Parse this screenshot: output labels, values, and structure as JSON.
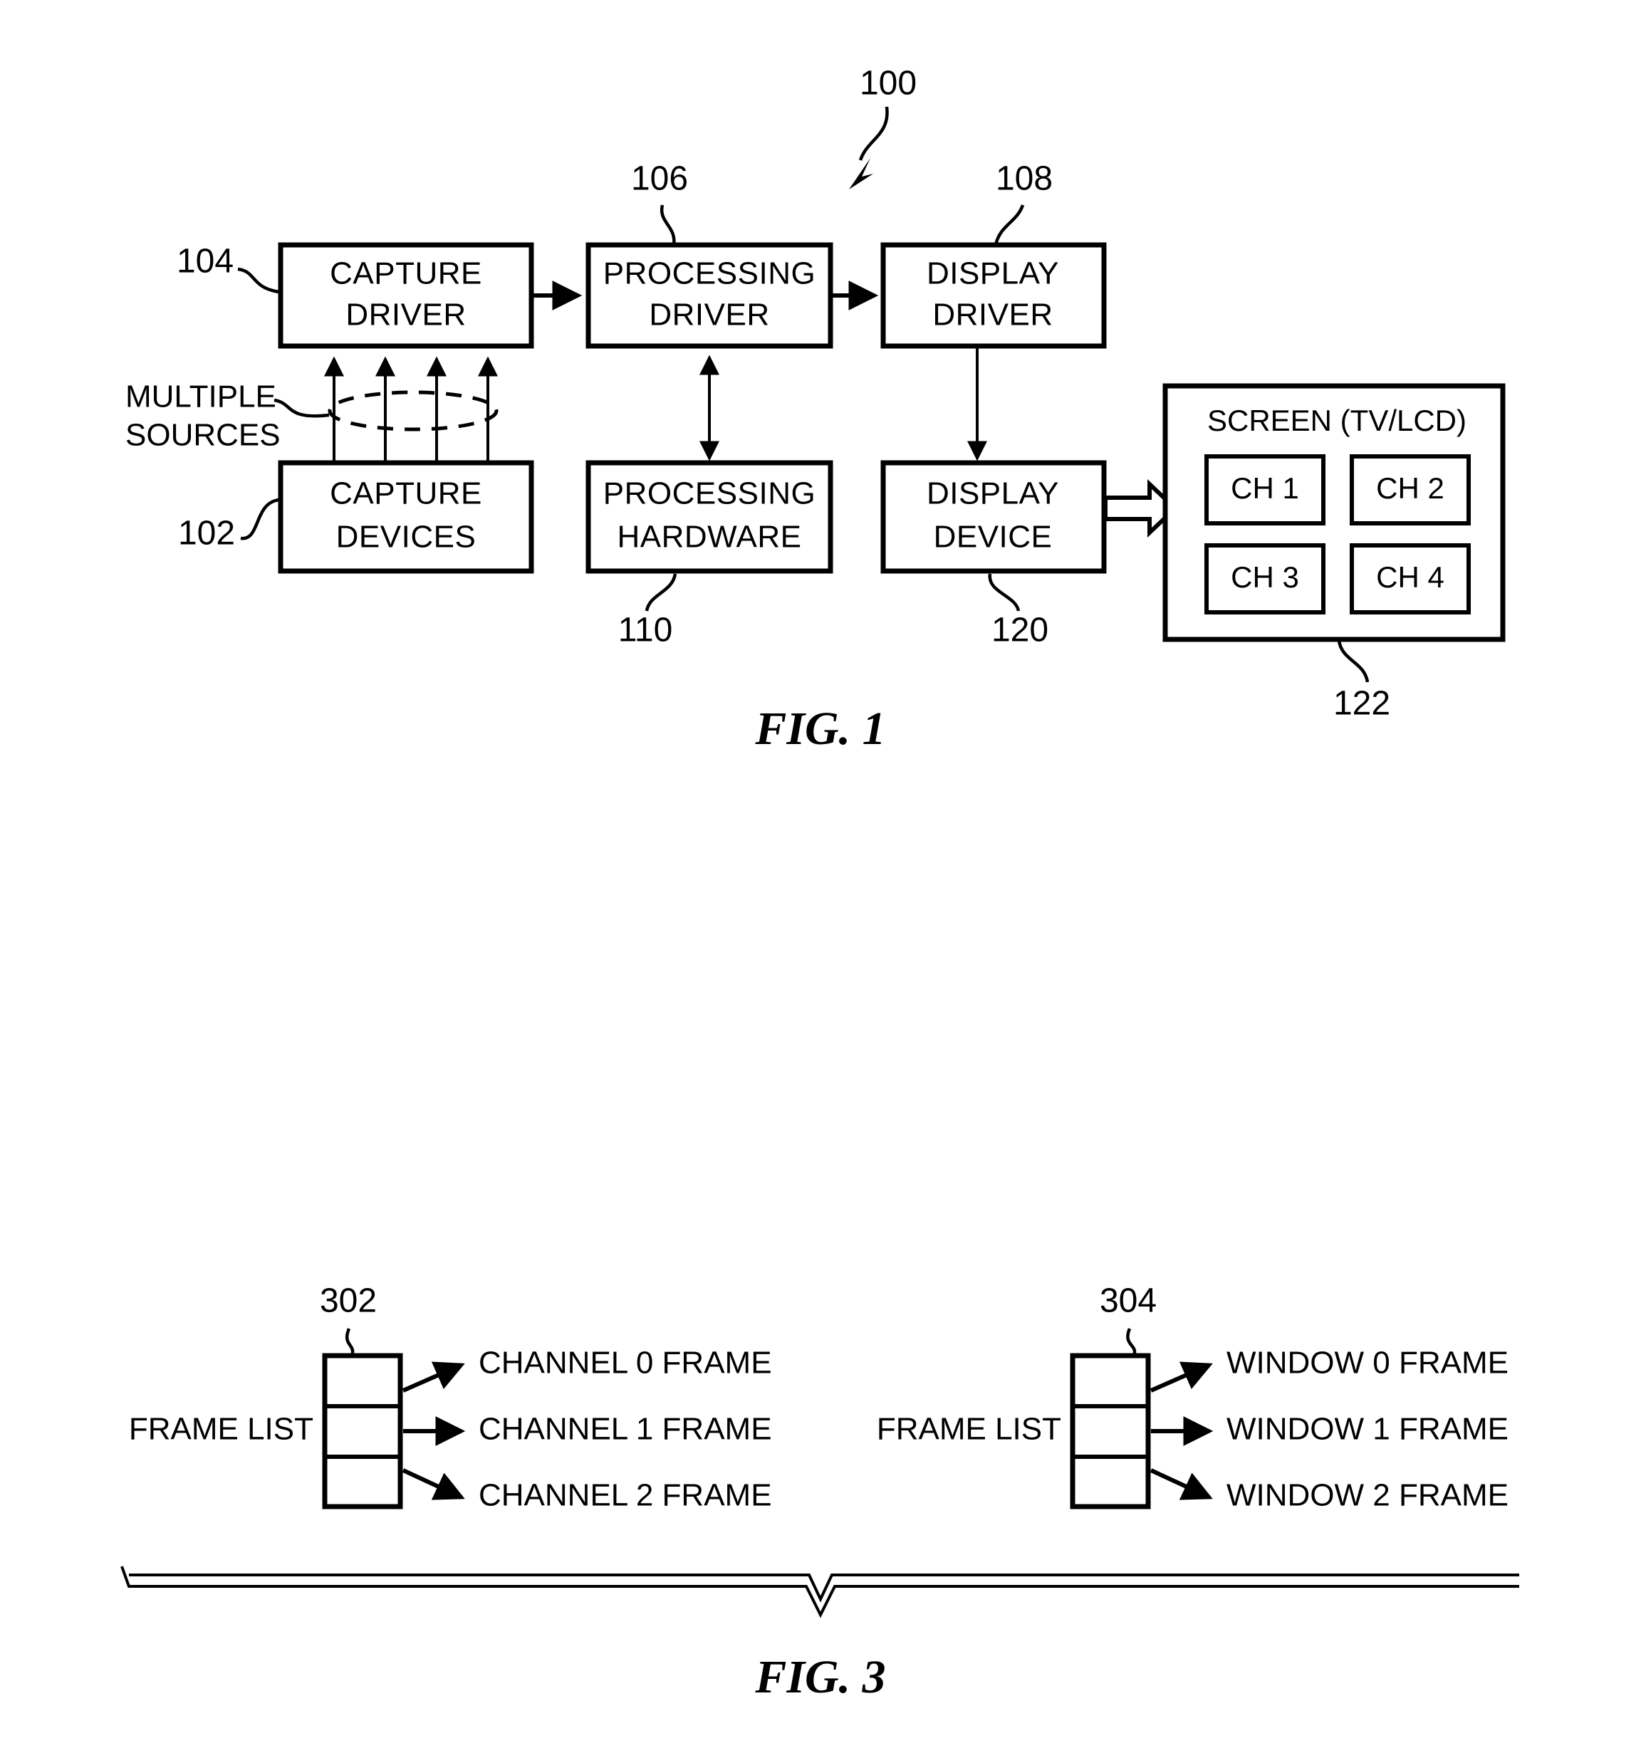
{
  "figures": [
    {
      "id": "fig1",
      "caption": "FIG. 1",
      "system_ref": "100",
      "blocks": {
        "capture_driver": {
          "line1": "CAPTURE",
          "line2": "DRIVER",
          "ref": "104"
        },
        "processing_driver": {
          "line1": "PROCESSING",
          "line2": "DRIVER",
          "ref": "106"
        },
        "display_driver": {
          "line1": "DISPLAY",
          "line2": "DRIVER",
          "ref": "108"
        },
        "capture_devices": {
          "line1": "CAPTURE",
          "line2": "DEVICES",
          "ref": "102"
        },
        "processing_hardware": {
          "line1": "PROCESSING",
          "line2": "HARDWARE",
          "ref": "110"
        },
        "display_device": {
          "line1": "DISPLAY",
          "line2": "DEVICE",
          "ref": "120"
        },
        "screen": {
          "title": "SCREEN (TV/LCD)",
          "ref": "122"
        }
      },
      "multiple_sources_label": {
        "line1": "MULTIPLE",
        "line2": "SOURCES"
      },
      "channels": [
        "CH 1",
        "CH 2",
        "CH 3",
        "CH 4"
      ]
    },
    {
      "id": "fig3",
      "caption": "FIG. 3",
      "lists": [
        {
          "ref": "302",
          "label": "FRAME LIST",
          "entries": [
            "CHANNEL 0 FRAME",
            "CHANNEL 1 FRAME",
            "CHANNEL 2 FRAME"
          ]
        },
        {
          "ref": "304",
          "label": "FRAME LIST",
          "entries": [
            "WINDOW 0 FRAME",
            "WINDOW 1 FRAME",
            "WINDOW 2 FRAME"
          ]
        }
      ]
    }
  ],
  "colors": {
    "ink": "#000000",
    "paper": "#ffffff"
  }
}
